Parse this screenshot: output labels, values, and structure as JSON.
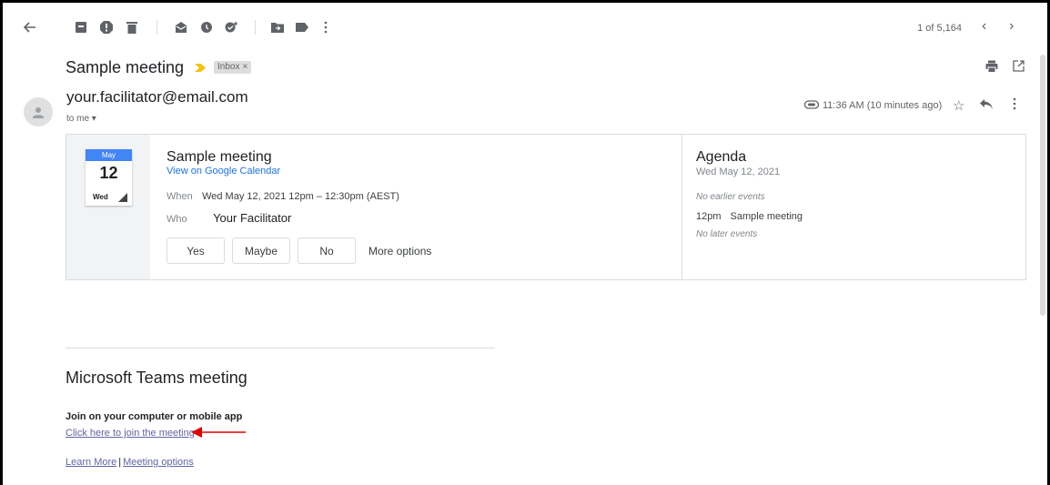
{
  "toolbar": {
    "icons": [
      "back-arrow-icon",
      "archive-icon",
      "report-spam-icon",
      "delete-icon",
      "mark-unread-icon",
      "snooze-icon",
      "add-task-icon",
      "move-to-icon",
      "labels-icon",
      "more-vert-icon"
    ],
    "pager": "1 of 5,164",
    "prev": "‹",
    "next": "›"
  },
  "email": {
    "subject": "Sample meeting",
    "label": "Inbox",
    "label_close": "×",
    "sender": "your.facilitator@email.com",
    "to": "to me ▾",
    "time": "11:36 AM (10 minutes ago)"
  },
  "invite": {
    "cal_month": "May",
    "cal_day": "12",
    "cal_dow": "Wed",
    "title": "Sample meeting",
    "view_link": "View on Google Calendar",
    "when_label": "When",
    "when_value": "Wed May 12, 2021 12pm – 12:30pm (AEST)",
    "who_label": "Who",
    "who_value": "Your Facilitator",
    "rsvp_yes": "Yes",
    "rsvp_maybe": "Maybe",
    "rsvp_no": "No",
    "more_options": "More options"
  },
  "agenda": {
    "title": "Agenda",
    "date": "Wed May 12, 2021",
    "no_earlier": "No earlier events",
    "event_time": "12pm",
    "event_name": "Sample meeting",
    "no_later": "No later events"
  },
  "teams": {
    "title": "Microsoft Teams meeting",
    "join_label": "Join on your computer or mobile app",
    "join_link": "Click here to join the meeting",
    "learn_more": "Learn More",
    "separator": "|",
    "meeting_options": "Meeting options"
  },
  "colors": {
    "link_blue": "#1a73e8",
    "teams_purple": "#6264a7",
    "calendar_blue": "#4285f4",
    "label_chevron": "#f4c20d",
    "annotation_arrow": "#e00000"
  }
}
